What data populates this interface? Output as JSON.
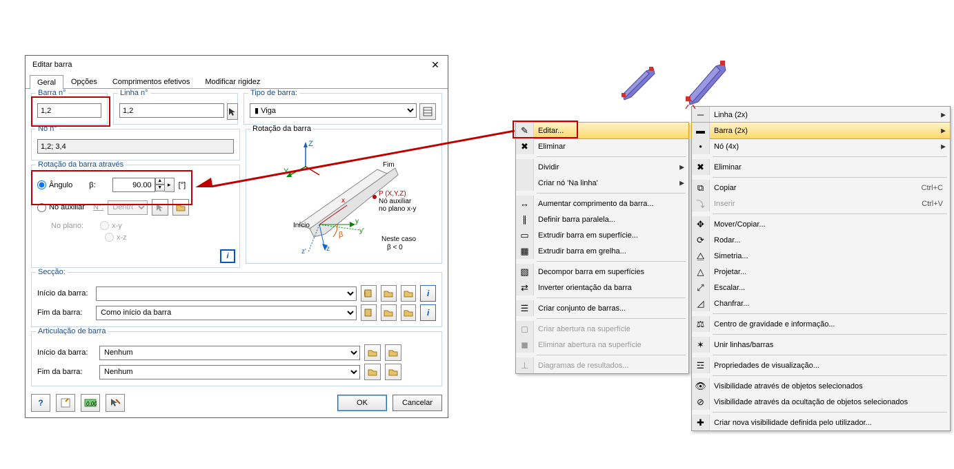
{
  "dialog": {
    "title": "Editar barra",
    "tabs": [
      "Geral",
      "Opções",
      "Comprimentos efetivos",
      "Modificar rigidez"
    ],
    "barra_no_label": "Barra n°",
    "barra_no_value": "1,2",
    "linha_no_label": "Linha n°",
    "linha_no_value": "1,2",
    "tipo_barra_label": "Tipo de barra:",
    "tipo_barra_value": "Viga",
    "no_no_label": "Nó n°",
    "no_no_value": "1,2; 3,4",
    "rot_group_label": "Rotação da barra através",
    "rot_angulo": "Ângulo",
    "rot_beta": "β:",
    "rot_value": "90.00",
    "rot_unit": "[°]",
    "no_aux": "Nó auxiliar",
    "no_aux_n": "N°.",
    "no_aux_dentro": "Dentro",
    "no_plano": "No plano:",
    "plano_xy": "x-y",
    "plano_xz": "x-z",
    "rot_preview_label": "Rotação da barra",
    "rot_preview_inicio": "Início",
    "rot_preview_fim": "Fim",
    "rot_preview_p": "P (X,Y,Z)",
    "rot_preview_p2": "Nó auxiliar",
    "rot_preview_p3": "no plano x-y",
    "rot_preview_case": "Neste caso",
    "rot_preview_case2": "β < 0",
    "seccao_label": "Secção:",
    "inicio_barra": "Início da barra:",
    "fim_barra": "Fim da barra:",
    "fim_barra_value": "Como início da barra",
    "artic_label": "Articulação de barra",
    "artic_inicio_value": "Nenhum",
    "artic_fim_value": "Nenhum",
    "ok": "OK",
    "cancel": "Cancelar"
  },
  "ctx1": {
    "items": [
      {
        "label": "Editar...",
        "hl": true
      },
      {
        "label": "Eliminar"
      },
      {
        "sep": true
      },
      {
        "label": "Dividir",
        "sub": true
      },
      {
        "label": "Criar nó 'Na linha'",
        "sub": true
      },
      {
        "sep": true
      },
      {
        "label": "Aumentar comprimento da barra..."
      },
      {
        "label": "Definir barra paralela..."
      },
      {
        "label": "Extrudir barra em superfície..."
      },
      {
        "label": "Extrudir barra em grelha..."
      },
      {
        "sep": true
      },
      {
        "label": "Decompor barra em superfícies"
      },
      {
        "label": "Inverter orientação da barra"
      },
      {
        "sep": true
      },
      {
        "label": "Criar conjunto de barras..."
      },
      {
        "sep": true
      },
      {
        "label": "Criar abertura na superfície",
        "disabled": true
      },
      {
        "label": "Eliminar abertura na superfície",
        "disabled": true
      },
      {
        "sep": true
      },
      {
        "label": "Diagramas de resultados...",
        "disabled": true
      }
    ]
  },
  "ctx2": {
    "items": [
      {
        "label": "Linha (2x)",
        "sub": true
      },
      {
        "label": "Barra (2x)",
        "sub": true,
        "hl": true
      },
      {
        "label": "Nó (4x)",
        "sub": true
      },
      {
        "sep": true
      },
      {
        "label": "Eliminar"
      },
      {
        "sep": true
      },
      {
        "label": "Copiar",
        "sc": "Ctrl+C"
      },
      {
        "label": "Inserir",
        "sc": "Ctrl+V",
        "disabled": true
      },
      {
        "sep": true
      },
      {
        "label": "Mover/Copiar..."
      },
      {
        "label": "Rodar..."
      },
      {
        "label": "Simetria..."
      },
      {
        "label": "Projetar..."
      },
      {
        "label": "Escalar..."
      },
      {
        "label": "Chanfrar..."
      },
      {
        "sep": true
      },
      {
        "label": "Centro de gravidade e informação..."
      },
      {
        "sep": true
      },
      {
        "label": "Unir linhas/barras"
      },
      {
        "sep": true
      },
      {
        "label": "Propriedades de visualização..."
      },
      {
        "sep": true
      },
      {
        "label": "Visibilidade através de objetos selecionados"
      },
      {
        "label": "Visibilidade através da ocultação de objetos selecionados"
      },
      {
        "sep": true
      },
      {
        "label": "Criar nova visibilidade definida pelo utilizador..."
      }
    ]
  }
}
